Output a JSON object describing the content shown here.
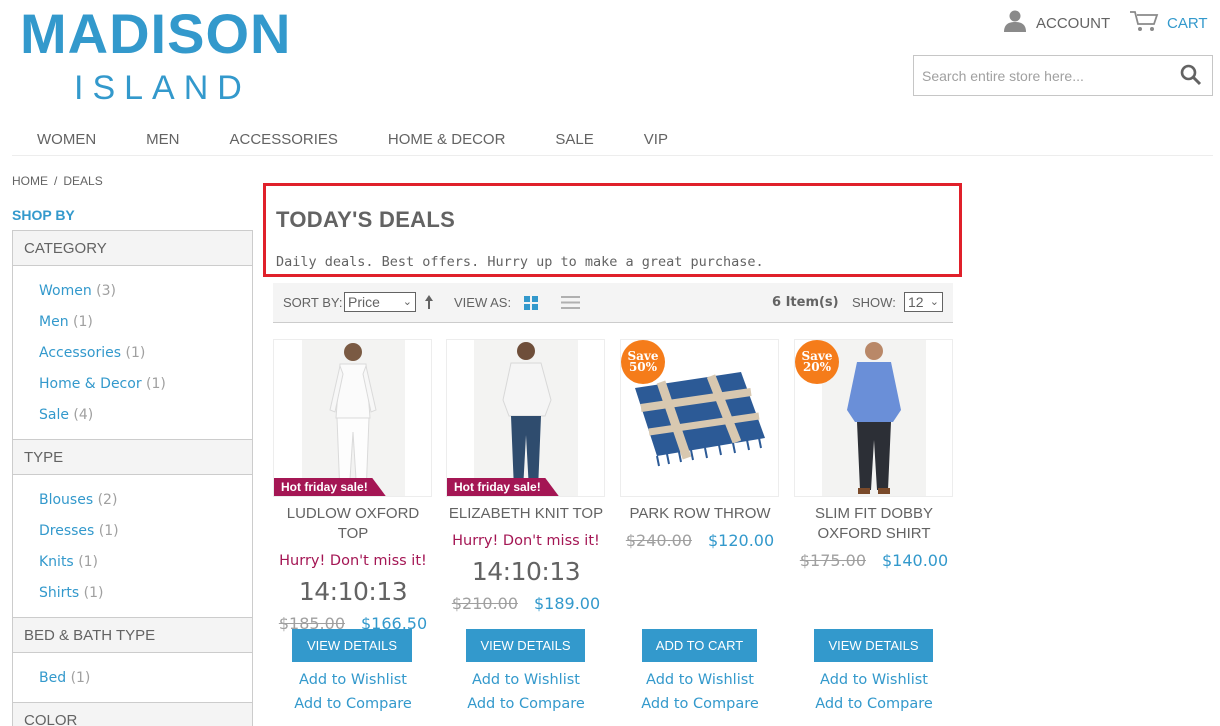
{
  "header": {
    "logo_line1": "MADISON",
    "logo_line2": "ISLAND",
    "account_label": "ACCOUNT",
    "cart_label": "CART",
    "search_placeholder": "Search entire store here..."
  },
  "nav": [
    "WOMEN",
    "MEN",
    "ACCESSORIES",
    "HOME & DECOR",
    "SALE",
    "VIP"
  ],
  "breadcrumb": {
    "home": "HOME",
    "sep": "/",
    "current": "DEALS"
  },
  "sidebar": {
    "title": "SHOP BY",
    "groups": [
      {
        "name": "CATEGORY",
        "items": [
          {
            "label": "Women",
            "count": "(3)"
          },
          {
            "label": "Men",
            "count": "(1)"
          },
          {
            "label": "Accessories",
            "count": "(1)"
          },
          {
            "label": "Home & Decor",
            "count": "(1)"
          },
          {
            "label": "Sale",
            "count": "(4)"
          }
        ]
      },
      {
        "name": "TYPE",
        "items": [
          {
            "label": "Blouses",
            "count": "(2)"
          },
          {
            "label": "Dresses",
            "count": "(1)"
          },
          {
            "label": "Knits",
            "count": "(1)"
          },
          {
            "label": "Shirts",
            "count": "(1)"
          }
        ]
      },
      {
        "name": "BED & BATH TYPE",
        "items": [
          {
            "label": "Bed",
            "count": "(1)"
          }
        ]
      },
      {
        "name": "COLOR",
        "items": []
      }
    ]
  },
  "page": {
    "title": "TODAY'S DEALS",
    "description": "Daily deals. Best offers. Hurry up to make a great purchase."
  },
  "toolbar": {
    "sort_label": "SORT BY:",
    "sort_value": "Price",
    "view_label": "VIEW AS:",
    "items_count": "6 Item(s)",
    "show_label": "SHOW:",
    "show_value": "12"
  },
  "products": [
    {
      "name": "LUDLOW OXFORD TOP",
      "badge": "Hot friday sale!",
      "hurry": "Hurry! Don't miss it!",
      "timer": "14:10:13",
      "old_price": "$185.00",
      "price": "$166.50",
      "button": "VIEW DETAILS",
      "wishlist": "Add to Wishlist",
      "compare": "Add to Compare"
    },
    {
      "name": "ELIZABETH KNIT TOP",
      "badge": "Hot friday sale!",
      "hurry": "Hurry! Don't miss it!",
      "timer": "14:10:13",
      "old_price": "$210.00",
      "price": "$189.00",
      "button": "VIEW DETAILS",
      "wishlist": "Add to Wishlist",
      "compare": "Add to Compare"
    },
    {
      "name": "PARK ROW THROW",
      "save_line1": "Save",
      "save_line2": "50%",
      "old_price": "$240.00",
      "price": "$120.00",
      "button": "ADD TO CART",
      "wishlist": "Add to Wishlist",
      "compare": "Add to Compare"
    },
    {
      "name_line1": "SLIM FIT DOBBY",
      "name_line2": "OXFORD SHIRT",
      "save_line1": "Save",
      "save_line2": "20%",
      "old_price": "$175.00",
      "price": "$140.00",
      "button": "VIEW DETAILS",
      "wishlist": "Add to Wishlist",
      "compare": "Add to Compare"
    }
  ],
  "colors": {
    "accent": "#3399cc",
    "highlight_box": "#e0202a",
    "sale_badge": "#a41654",
    "save_badge": "#f57c1a"
  }
}
